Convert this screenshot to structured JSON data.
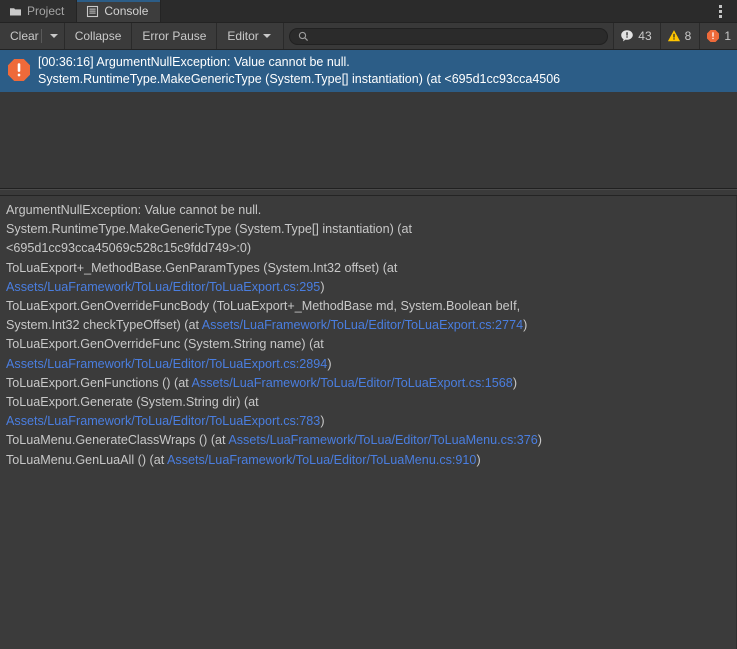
{
  "window": {
    "title": "Console",
    "overflow_menu_icon": "kebab-menu-icon"
  },
  "tabs": [
    {
      "label": "Project",
      "icon": "folder-icon",
      "active": false
    },
    {
      "label": "Console",
      "icon": "console-icon",
      "active": true
    }
  ],
  "toolbar": {
    "clear_label": "Clear",
    "clear_dropdown_icon": "chevron-down-icon",
    "collapse_label": "Collapse",
    "error_pause_label": "Error Pause",
    "editor_label": "Editor",
    "editor_dropdown_icon": "chevron-down-icon",
    "search": {
      "value": "",
      "placeholder": "",
      "icon": "search-icon"
    },
    "counters": [
      {
        "name": "log-count",
        "icon": "info-icon",
        "count": "43",
        "color": "#e3e3e3"
      },
      {
        "name": "warning-count",
        "icon": "warning-icon",
        "count": "8",
        "color": "#ffc500"
      },
      {
        "name": "error-count",
        "icon": "error-icon",
        "count": "1",
        "color": "#ee6a3a"
      }
    ]
  },
  "log_list": {
    "selected_entry": {
      "icon": "error-icon",
      "line1": "[00:36:16] ArgumentNullException: Value cannot be null.",
      "line2": "System.RuntimeType.MakeGenericType (System.Type[] instantiation) (at <695d1cc93cca4506",
      "selected": true,
      "selection_color": "#2c5d87"
    }
  },
  "detail_pane": {
    "stack_trace_segments": [
      {
        "text": "ArgumentNullException: Value cannot be null.\nSystem.RuntimeType.MakeGenericType (System.Type[] instantiation) (at\n<695d1cc93cca45069c528c15c9fdd749>:0)\nToLuaExport+_MethodBase.GenParamTypes (System.Int32 offset) (at\n",
        "link": false
      },
      {
        "text": "Assets/LuaFramework/ToLua/Editor/ToLuaExport.cs:295",
        "link": true
      },
      {
        "text": ")\nToLuaExport.GenOverrideFuncBody (ToLuaExport+_MethodBase md, System.Boolean beIf,\nSystem.Int32 checkTypeOffset) (at ",
        "link": false
      },
      {
        "text": "Assets/LuaFramework/ToLua/Editor/ToLuaExport.cs:2774",
        "link": true
      },
      {
        "text": ")\nToLuaExport.GenOverrideFunc (System.String name) (at\n",
        "link": false
      },
      {
        "text": "Assets/LuaFramework/ToLua/Editor/ToLuaExport.cs:2894",
        "link": true
      },
      {
        "text": ")\nToLuaExport.GenFunctions () (at ",
        "link": false
      },
      {
        "text": "Assets/LuaFramework/ToLua/Editor/ToLuaExport.cs:1568",
        "link": true
      },
      {
        "text": ")\nToLuaExport.Generate (System.String dir) (at\n",
        "link": false
      },
      {
        "text": "Assets/LuaFramework/ToLua/Editor/ToLuaExport.cs:783",
        "link": true
      },
      {
        "text": ")\nToLuaMenu.GenerateClassWraps () (at ",
        "link": false
      },
      {
        "text": "Assets/LuaFramework/ToLua/Editor/ToLuaMenu.cs:376",
        "link": true
      },
      {
        "text": ")\nToLuaMenu.GenLuaAll () (at ",
        "link": false
      },
      {
        "text": "Assets/LuaFramework/ToLua/Editor/ToLuaMenu.cs:910",
        "link": true
      },
      {
        "text": ")",
        "link": false
      }
    ]
  }
}
